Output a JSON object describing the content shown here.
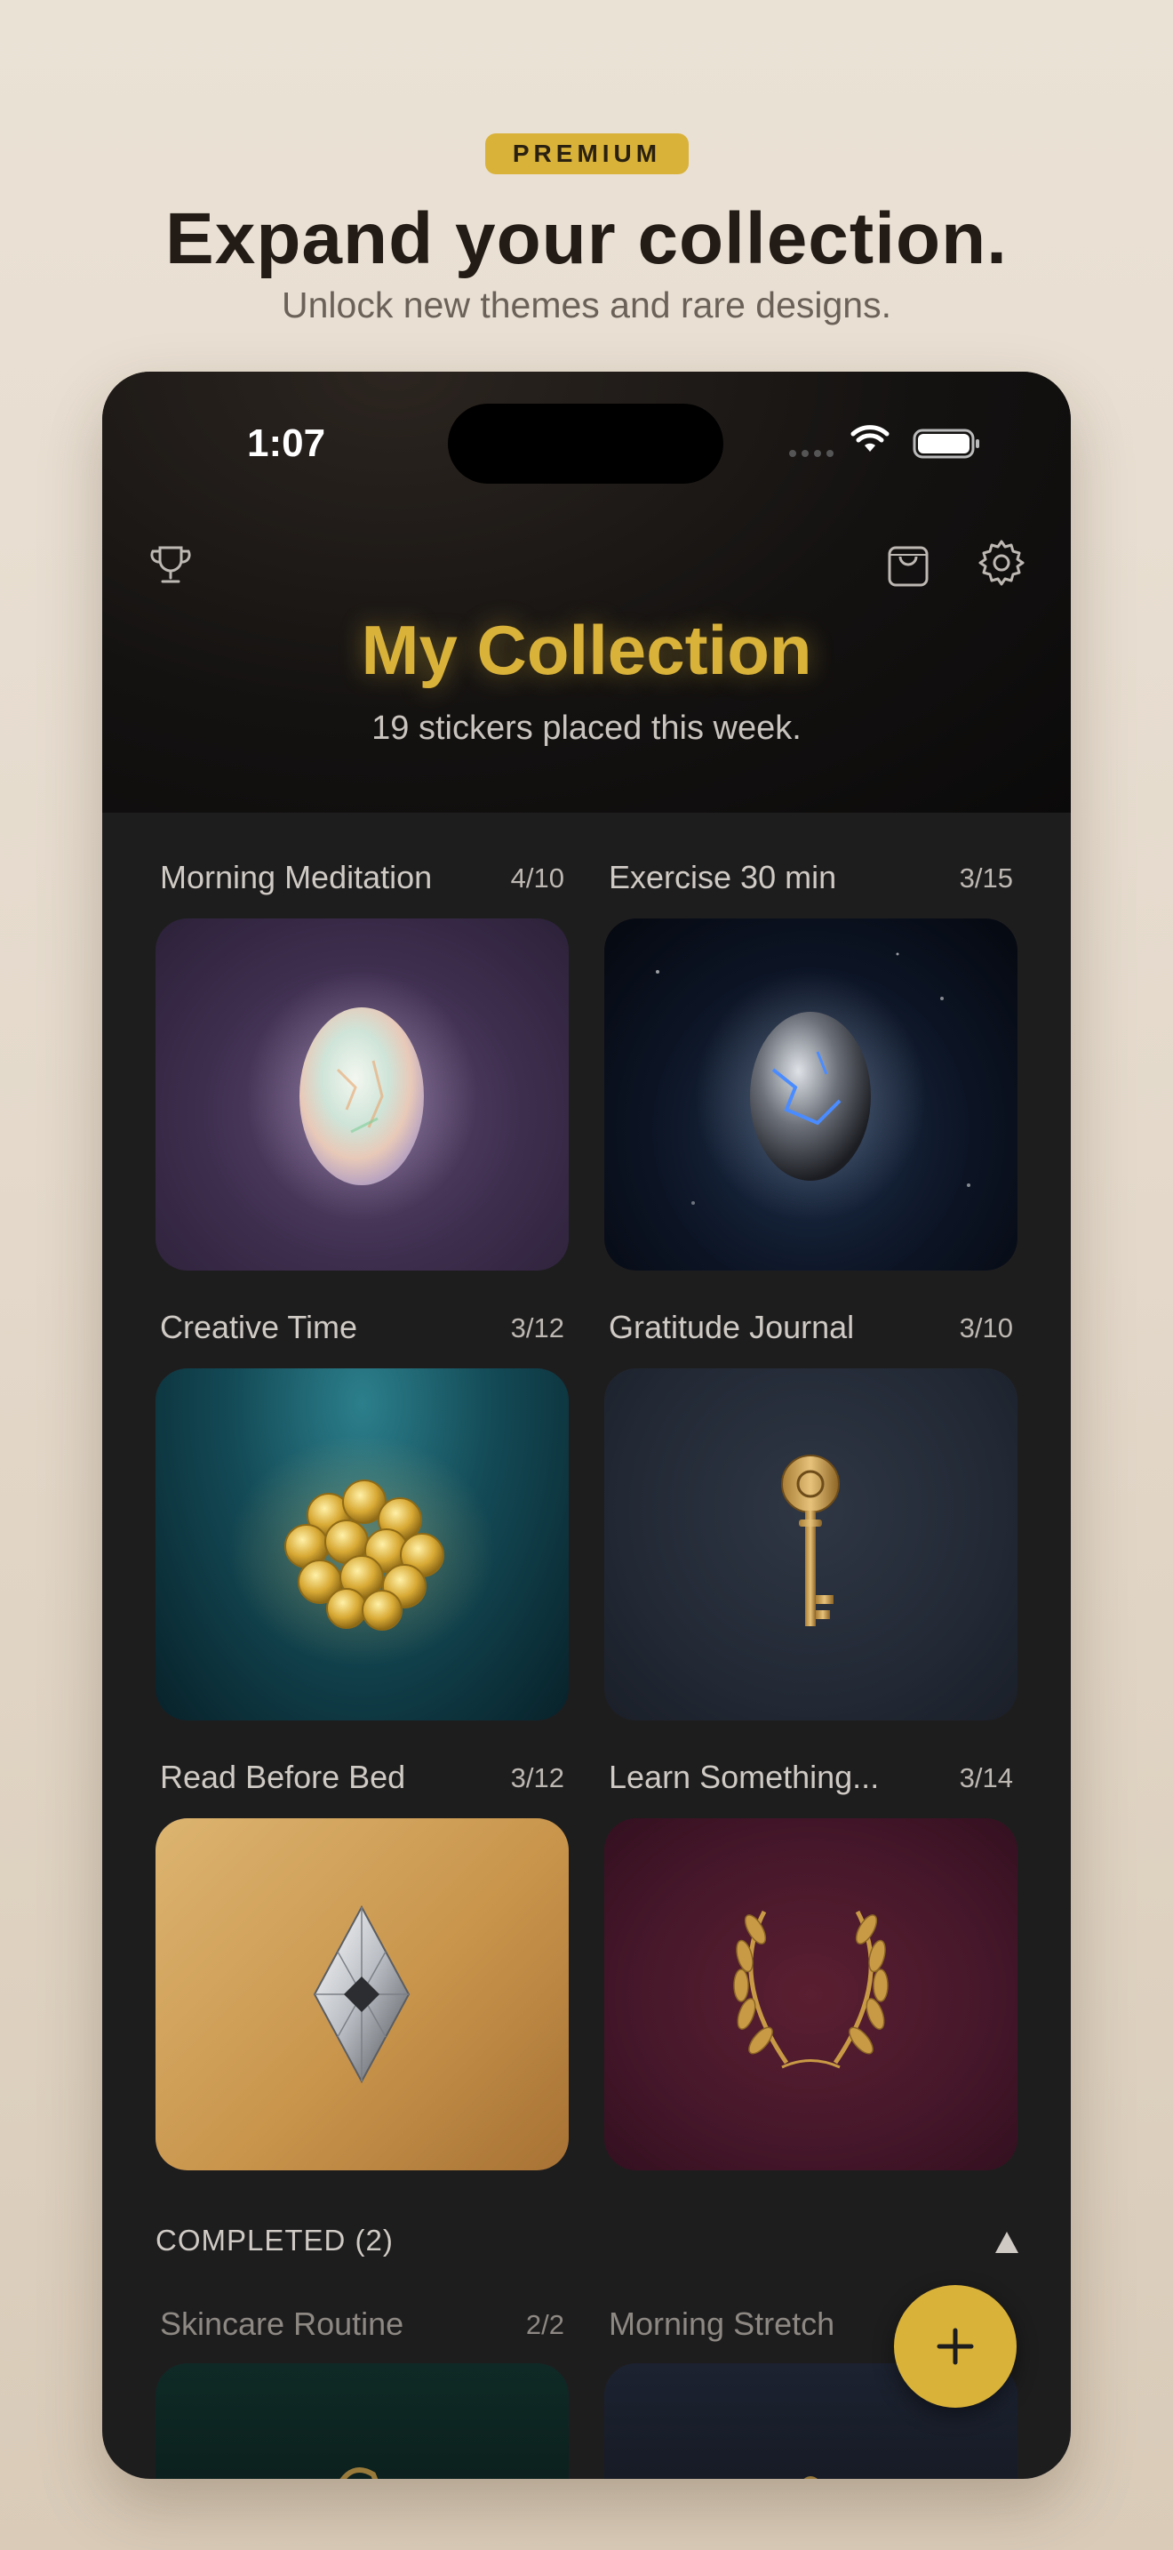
{
  "promo": {
    "badge": "PREMIUM",
    "headline": "Expand your collection.",
    "subhead": "Unlock new themes and rare designs."
  },
  "status_bar": {
    "time": "1:07"
  },
  "header": {
    "title": "My Collection",
    "subtitle": "19 stickers placed this week."
  },
  "colors": {
    "accent": "#d9b23a",
    "background": "#1e1d1e"
  },
  "collections": [
    {
      "label": "Morning Meditation",
      "count": "4/10",
      "icon": "opal-sticker"
    },
    {
      "label": "Exercise 30 min",
      "count": "3/15",
      "icon": "storm-egg-sticker"
    },
    {
      "label": "Creative Time",
      "count": "3/12",
      "icon": "gold-coins-sticker"
    },
    {
      "label": "Gratitude Journal",
      "count": "3/10",
      "icon": "rose-key-sticker"
    },
    {
      "label": "Read Before Bed",
      "count": "3/12",
      "icon": "diamond-sticker"
    },
    {
      "label": "Learn Something...",
      "count": "3/14",
      "icon": "laurel-wreath-sticker"
    }
  ],
  "completed": {
    "label": "COMPLETED (2)",
    "items": [
      {
        "label": "Skincare Routine",
        "count": "2/2"
      },
      {
        "label": "Morning Stretch",
        "count": ""
      }
    ]
  },
  "fab": {
    "icon": "plus-icon"
  }
}
